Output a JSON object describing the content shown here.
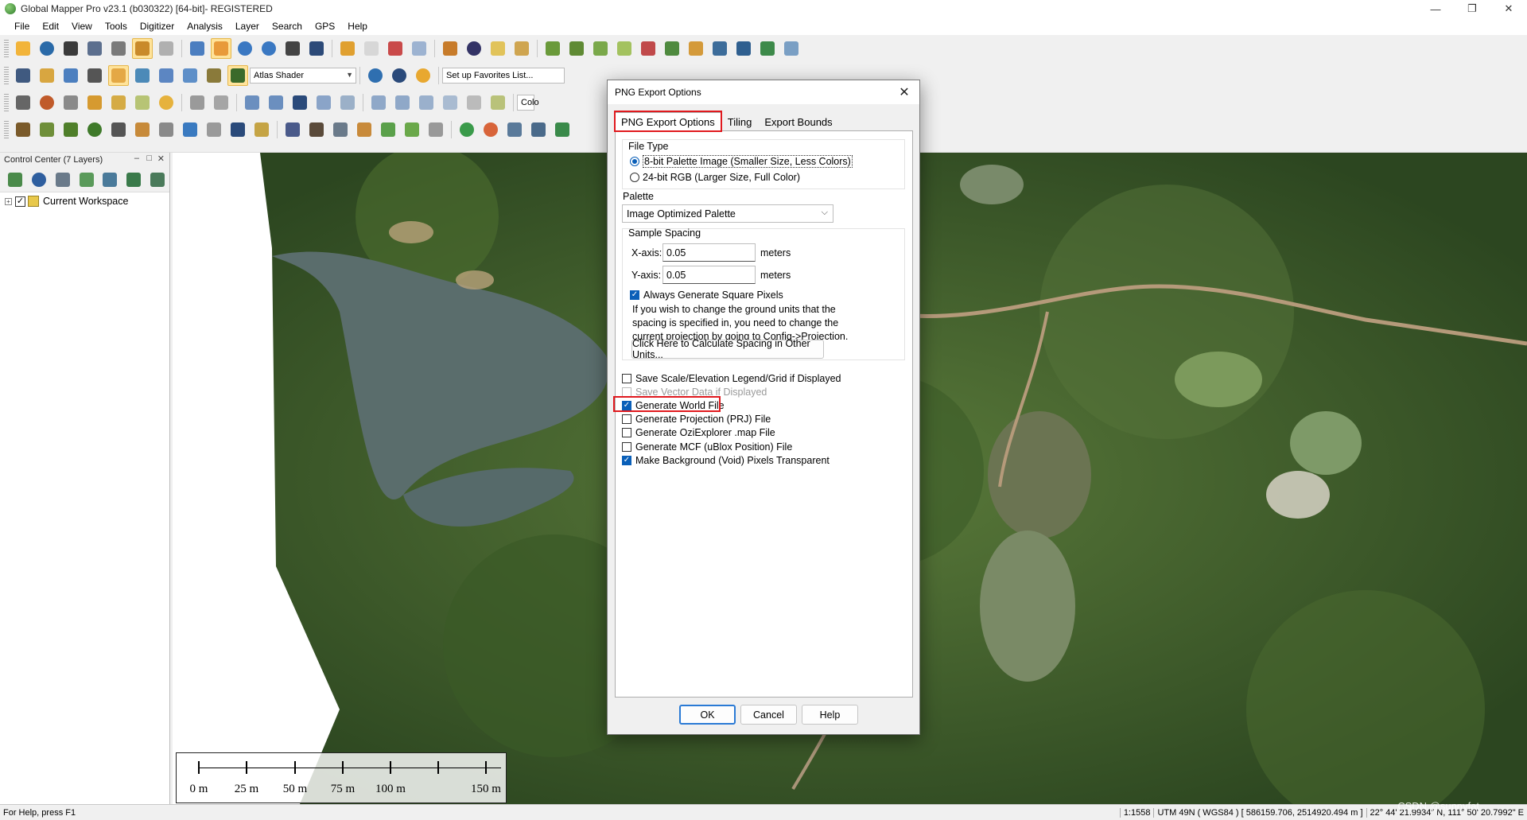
{
  "window": {
    "title": "Global Mapper Pro v23.1 (b030322) [64-bit]- REGISTERED",
    "controls": [
      "—",
      "❐",
      "✕"
    ]
  },
  "menu": [
    "File",
    "Edit",
    "View",
    "Tools",
    "Digitizer",
    "Analysis",
    "Layer",
    "Search",
    "GPS",
    "Help"
  ],
  "toolbar": {
    "shader_combo": "Atlas Shader",
    "favorites_combo": "Set up Favorites List...",
    "color_combo": "Colo"
  },
  "control_center": {
    "title": "Control Center (7 Layers)",
    "head_controls": [
      "–",
      "□",
      "✕"
    ],
    "workspace_label": "Current Workspace"
  },
  "scalebar": {
    "labels": [
      "0 m",
      "25 m",
      "50 m",
      "75 m",
      "100 m",
      "150 m"
    ]
  },
  "status": {
    "help": "For Help, press F1",
    "scale": "1:1558",
    "projection": "UTM 49N ( WGS84 ) [ 586159.706, 2514920.494 m ]",
    "latlon": "22° 44' 21.9934\" N, 111° 50' 20.7992\" E"
  },
  "watermark": "CSDN @sunnyfat",
  "dialog": {
    "title": "PNG Export Options",
    "close": "✕",
    "tabs": [
      "PNG Export Options",
      "Tiling",
      "Export Bounds"
    ],
    "file_type": {
      "label": "File Type",
      "options": [
        "8-bit Palette Image (Smaller Size, Less Colors)",
        "24-bit RGB (Larger Size, Full Color)"
      ],
      "selected_index": 0
    },
    "palette": {
      "label": "Palette",
      "value": "Image Optimized Palette"
    },
    "sample_spacing": {
      "label": "Sample Spacing",
      "x_label": "X-axis:",
      "x_value": "0.05",
      "x_unit": "meters",
      "y_label": "Y-axis:",
      "y_value": "0.05",
      "y_unit": "meters",
      "square_label": "Always Generate Square Pixels",
      "square_checked": true,
      "note": "If you wish to change the ground units that the spacing is specified in, you need to change the current projection by going to Config->Projection.",
      "calc_button": "Click Here to Calculate Spacing in Other Units..."
    },
    "options": [
      {
        "label": "Save Scale/Elevation Legend/Grid if Displayed",
        "checked": false,
        "disabled": false
      },
      {
        "label": "Save Vector Data if Displayed",
        "checked": false,
        "disabled": true
      },
      {
        "label": "Generate World File",
        "checked": true,
        "disabled": false
      },
      {
        "label": "Generate Projection (PRJ) File",
        "checked": false,
        "disabled": false
      },
      {
        "label": "Generate OziExplorer .map File",
        "checked": false,
        "disabled": false
      },
      {
        "label": "Generate MCF (uBlox Position) File",
        "checked": false,
        "disabled": false
      },
      {
        "label": "Make Background (Void) Pixels Transparent",
        "checked": true,
        "disabled": false
      }
    ],
    "buttons": {
      "ok": "OK",
      "cancel": "Cancel",
      "help": "Help"
    }
  },
  "colors": {
    "highlight": "#e0191e",
    "accent": "#0a5fb8",
    "map_vegetation": "#2f4a22"
  }
}
